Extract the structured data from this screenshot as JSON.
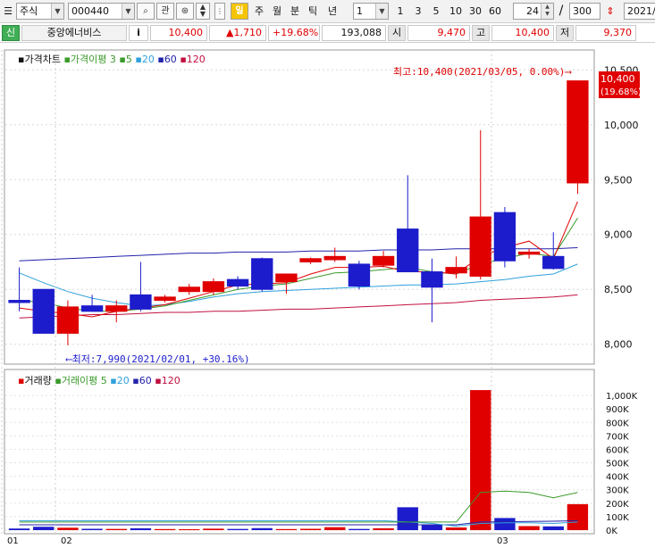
{
  "toolbar": {
    "market_select": "주식",
    "stock_code": "000440",
    "search_icon": "search-icon",
    "watch_label": "관",
    "live_label": "일",
    "period_tabs": [
      "주",
      "월",
      "분",
      "틱",
      "년"
    ],
    "interval_value": "1",
    "interval_buttons": [
      "1",
      "3",
      "5",
      "10",
      "30",
      "60"
    ],
    "count_value": "24",
    "slash": "/",
    "total_value": "300",
    "date_value": "2021/"
  },
  "quote": {
    "badge": "신",
    "stock_name": "중앙에너비스",
    "info_button": "i",
    "price": "10,400",
    "change": "▲1,710",
    "change_pct": "+19.68%",
    "volume": "193,088",
    "open_label": "시",
    "open_value": "9,470",
    "high_label": "고",
    "high_value": "10,400",
    "low_label": "저",
    "low_value": "9,370"
  },
  "price_legend": {
    "title": "가격차트",
    "ma_label": "가격이평",
    "ma_periods": [
      "3",
      "5",
      "20",
      "60",
      "120"
    ]
  },
  "volume_legend": {
    "title": "거래량",
    "ma_label": "거래이평",
    "ma_periods": [
      "5",
      "20",
      "60",
      "120"
    ]
  },
  "annotations": {
    "high_text": "최고:10,400(2021/03/05, 0.00%)⟶",
    "low_text": "⟵최저:7,990(2021/02/01, +30.16%)",
    "last_price": "10,400",
    "last_pct": "(19.68%)"
  },
  "colors": {
    "up": "#e00000",
    "down": "#1c1ccc",
    "ma3": "#e00000",
    "ma5": "#3a9a2a",
    "ma20": "#2fa0dc",
    "ma60": "#2222aa",
    "ma120": "#c01040"
  },
  "chart_data": [
    {
      "type": "candlestick",
      "title": "가격차트",
      "ylim": [
        7900,
        10600
      ],
      "y_ticks": [
        "10,500",
        "10,000",
        "9,500",
        "9,000",
        "8,500",
        "8,000"
      ],
      "candles": [
        {
          "open": 8400,
          "high": 8700,
          "low": 8300,
          "close": 8380
        },
        {
          "open": 8500,
          "high": 8500,
          "low": 8100,
          "close": 8100
        },
        {
          "open": 8100,
          "high": 8400,
          "low": 7990,
          "close": 8340
        },
        {
          "open": 8350,
          "high": 8450,
          "low": 8300,
          "close": 8300
        },
        {
          "open": 8300,
          "high": 8400,
          "low": 8200,
          "close": 8350
        },
        {
          "open": 8450,
          "high": 8750,
          "low": 8300,
          "close": 8320
        },
        {
          "open": 8400,
          "high": 8450,
          "low": 8380,
          "close": 8430
        },
        {
          "open": 8480,
          "high": 8550,
          "low": 8450,
          "close": 8520
        },
        {
          "open": 8480,
          "high": 8600,
          "low": 8450,
          "close": 8570
        },
        {
          "open": 8590,
          "high": 8620,
          "low": 8500,
          "close": 8530
        },
        {
          "open": 8780,
          "high": 8790,
          "low": 8480,
          "close": 8500
        },
        {
          "open": 8570,
          "high": 8640,
          "low": 8460,
          "close": 8640
        },
        {
          "open": 8750,
          "high": 8790,
          "low": 8730,
          "close": 8780
        },
        {
          "open": 8770,
          "high": 8880,
          "low": 8750,
          "close": 8800
        },
        {
          "open": 8730,
          "high": 8760,
          "low": 8500,
          "close": 8530
        },
        {
          "open": 8720,
          "high": 8850,
          "low": 8700,
          "close": 8800
        },
        {
          "open": 9050,
          "high": 9540,
          "low": 8660,
          "close": 8660
        },
        {
          "open": 8660,
          "high": 8780,
          "low": 8200,
          "close": 8520
        },
        {
          "open": 8650,
          "high": 8800,
          "low": 8600,
          "close": 8700
        },
        {
          "open": 8620,
          "high": 9950,
          "low": 8590,
          "close": 9160
        },
        {
          "open": 9200,
          "high": 9250,
          "low": 8700,
          "close": 8760
        },
        {
          "open": 8820,
          "high": 8870,
          "low": 8780,
          "close": 8840
        },
        {
          "open": 8800,
          "high": 9020,
          "low": 8680,
          "close": 8690
        },
        {
          "open": 9470,
          "high": 10400,
          "low": 9370,
          "close": 10400
        }
      ],
      "ma3": [
        8330,
        8300,
        8280,
        8250,
        8300,
        8330,
        8360,
        8420,
        8480,
        8540,
        8550,
        8560,
        8640,
        8700,
        8700,
        8710,
        8660,
        8660,
        8640,
        8800,
        8880,
        8940,
        8780,
        9300
      ],
      "ma5": [
        8400,
        8380,
        8330,
        8300,
        8300,
        8320,
        8350,
        8400,
        8450,
        8500,
        8530,
        8550,
        8600,
        8650,
        8660,
        8680,
        8700,
        8660,
        8640,
        8730,
        8780,
        8830,
        8800,
        9150
      ],
      "ma20": [
        8650,
        8560,
        8480,
        8420,
        8380,
        8350,
        8360,
        8390,
        8430,
        8460,
        8480,
        8490,
        8500,
        8510,
        8520,
        8530,
        8540,
        8540,
        8550,
        8570,
        8590,
        8620,
        8640,
        8730
      ],
      "ma60": [
        8760,
        8770,
        8780,
        8790,
        8800,
        8810,
        8820,
        8830,
        8830,
        8840,
        8840,
        8840,
        8850,
        8850,
        8850,
        8860,
        8860,
        8860,
        8870,
        8870,
        8870,
        8870,
        8870,
        8880
      ],
      "ma120": [
        8240,
        8250,
        8260,
        8270,
        8270,
        8280,
        8290,
        8290,
        8300,
        8300,
        8310,
        8320,
        8320,
        8330,
        8340,
        8350,
        8360,
        8370,
        8380,
        8400,
        8410,
        8420,
        8430,
        8450
      ]
    },
    {
      "type": "bar",
      "title": "거래량",
      "ylim": [
        0,
        1100000
      ],
      "y_ticks": [
        "1,000K",
        "900K",
        "800K",
        "700K",
        "600K",
        "500K",
        "400K",
        "300K",
        "200K",
        "100K",
        "0K"
      ],
      "x_tick_labels": [
        "01",
        "02",
        "03"
      ],
      "volumes": [
        12000,
        25000,
        18000,
        10000,
        9000,
        14000,
        8000,
        7000,
        11000,
        9000,
        15000,
        8000,
        10000,
        22000,
        9000,
        14000,
        170000,
        40000,
        20000,
        1040000,
        90000,
        30000,
        28000,
        193088
      ],
      "up": [
        false,
        false,
        true,
        false,
        true,
        false,
        true,
        true,
        true,
        false,
        false,
        true,
        true,
        true,
        false,
        true,
        false,
        false,
        true,
        true,
        false,
        true,
        false,
        true
      ],
      "vma5": [
        60000,
        60000,
        60000,
        60000,
        60000,
        60000,
        60000,
        60000,
        60000,
        60000,
        60000,
        60000,
        60000,
        60000,
        60000,
        60000,
        60000,
        60000,
        60000,
        280000,
        290000,
        280000,
        240000,
        280000
      ],
      "vma20": [
        70000,
        70000,
        70000,
        70000,
        70000,
        70000,
        70000,
        70000,
        70000,
        70000,
        70000,
        70000,
        70000,
        70000,
        70000,
        70000,
        60000,
        50000,
        30000,
        50000,
        55000,
        55000,
        50000,
        60000
      ],
      "vma60": [
        40000,
        40000,
        40000,
        40000,
        40000,
        40000,
        40000,
        40000,
        40000,
        40000,
        40000,
        40000,
        40000,
        40000,
        40000,
        40000,
        40000,
        40000,
        40000,
        60000,
        62000,
        64000,
        66000,
        70000
      ]
    }
  ]
}
